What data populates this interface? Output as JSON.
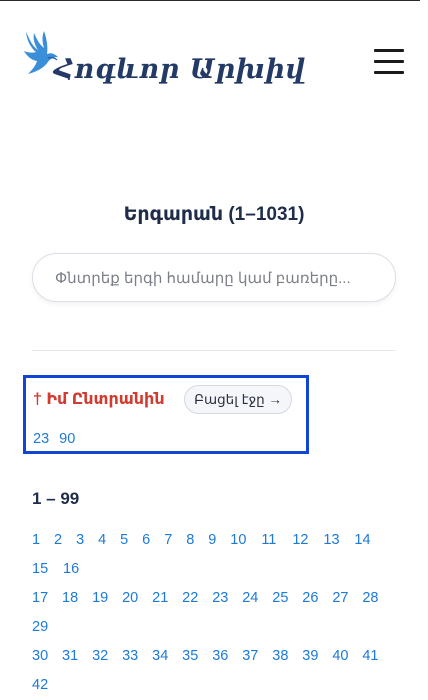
{
  "header": {
    "logo_text": "Հոգևոր Արխիվ",
    "menu_icon": "hamburger-menu-icon"
  },
  "main": {
    "title": "Երգարան (1–1031)",
    "search": {
      "placeholder": "Փնտրեք երգի համարը կամ բառերը...",
      "value": ""
    }
  },
  "favorites": {
    "title": "† Իմ Ընտրանին",
    "open_button": "Բացել էջը →",
    "items": [
      "23",
      "90"
    ]
  },
  "range_section": {
    "title": "1 – 99",
    "numbers": [
      "1",
      "2",
      "3",
      "4",
      "5",
      "6",
      "7",
      "8",
      "9",
      "10",
      "11",
      "12",
      "13",
      "14",
      "15",
      "16",
      "17",
      "18",
      "19",
      "20",
      "21",
      "22",
      "23",
      "24",
      "25",
      "26",
      "27",
      "28",
      "29",
      "30",
      "31",
      "32",
      "33",
      "34",
      "35",
      "36",
      "37",
      "38",
      "39",
      "40",
      "41",
      "42"
    ]
  },
  "colors": {
    "title": "#1f2d4a",
    "link": "#1c7ad8",
    "favorites_title": "#d23b2f",
    "highlight_border": "#1146d4",
    "logo": "#233a66"
  }
}
